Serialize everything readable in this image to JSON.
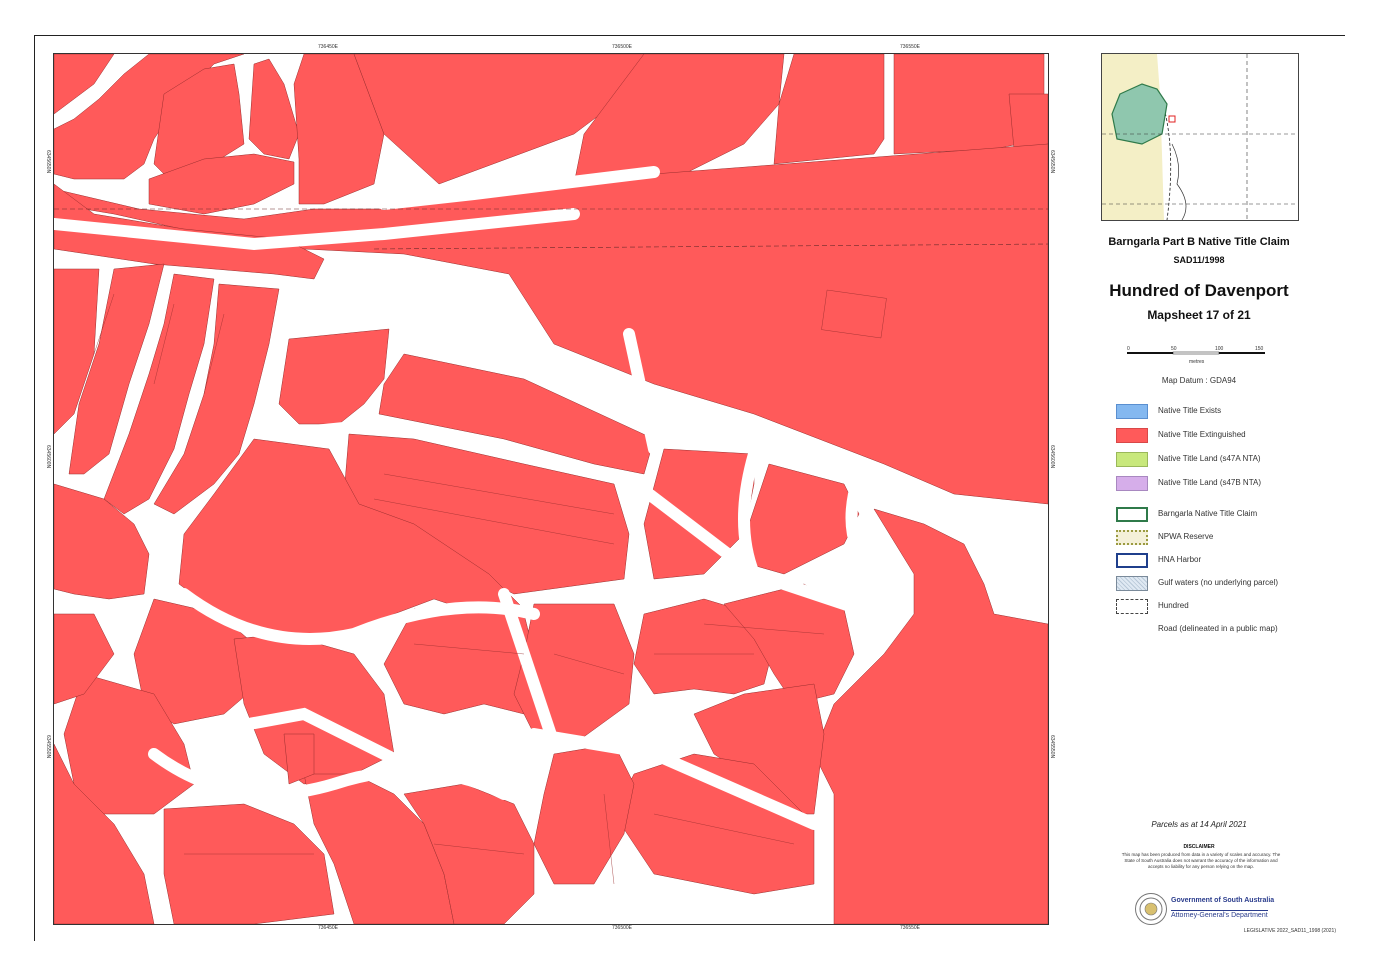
{
  "map": {
    "title": "Barngarla Part B Native Title Claim",
    "claim_number": "SAD11/1998",
    "hundred": "Hundred of Davenport",
    "mapsheet": "Mapsheet 17 of 21",
    "datum": "Map Datum : GDA94",
    "parcels_date": "Parcels as at 14 April 2021",
    "scale_labels": [
      "0",
      "50",
      "100",
      "150"
    ],
    "scale_unit": "metres"
  },
  "legend": [
    {
      "label": "Native Title Exists",
      "fill": "#84b8f0",
      "border": "#5a8fd0",
      "icon": "solid"
    },
    {
      "label": "Native Title Extinguished",
      "fill": "#ff5a5a",
      "border": "#d84848",
      "icon": "solid"
    },
    {
      "label": "Native Title Land (s47A NTA)",
      "fill": "#c8e87c",
      "border": "#9ab85a",
      "icon": "solid"
    },
    {
      "label": "Native Title Land (s47B NTA)",
      "fill": "#d6aeea",
      "border": "#a888c0",
      "icon": "solid"
    },
    {
      "label": "Barngarla Native Title Claim",
      "fill": "#ffffff",
      "border": "#2f7a4a",
      "icon": "outline"
    },
    {
      "label": "NPWA Reserve",
      "fill": "#f4f0d8",
      "border": "#9a9a40",
      "icon": "dotted"
    },
    {
      "label": "HNA Harbor",
      "fill": "#ffffff",
      "border": "#1f3f8c",
      "icon": "outline"
    },
    {
      "label": "Gulf waters (no underlying parcel)",
      "fill": "#e6eef6",
      "border": "#7a8a9a",
      "icon": "pattern"
    },
    {
      "label": "Hundred",
      "fill": "#ffffff",
      "border": "#444444",
      "icon": "dashed"
    },
    {
      "label": "Road (delineated in a public map)",
      "fill": "#ffffff",
      "border": "#ffffff",
      "icon": "none"
    }
  ],
  "disclaimer": {
    "title": "DISCLAIMER",
    "text": "This map has been produced from data in a variety of scales and accuracy. The State of South Australia does not warrant the accuracy of the information and accepts no liability for any person relying on the map."
  },
  "government": {
    "line1": "Government of South Australia",
    "line2": "Attorney-General's Department"
  },
  "footer_ref": "LEGISLATIVE 2022_SAD11_1998 (2021)",
  "colors": {
    "extinguished": "#ff5a5a",
    "road": "#ffffff",
    "parcel_line": "#9a2e2e"
  },
  "grid_ticks": {
    "top": [
      "736450E",
      "736500E",
      "736550E"
    ],
    "left": [
      "6345650N",
      "6345600N",
      "6345550N"
    ]
  }
}
